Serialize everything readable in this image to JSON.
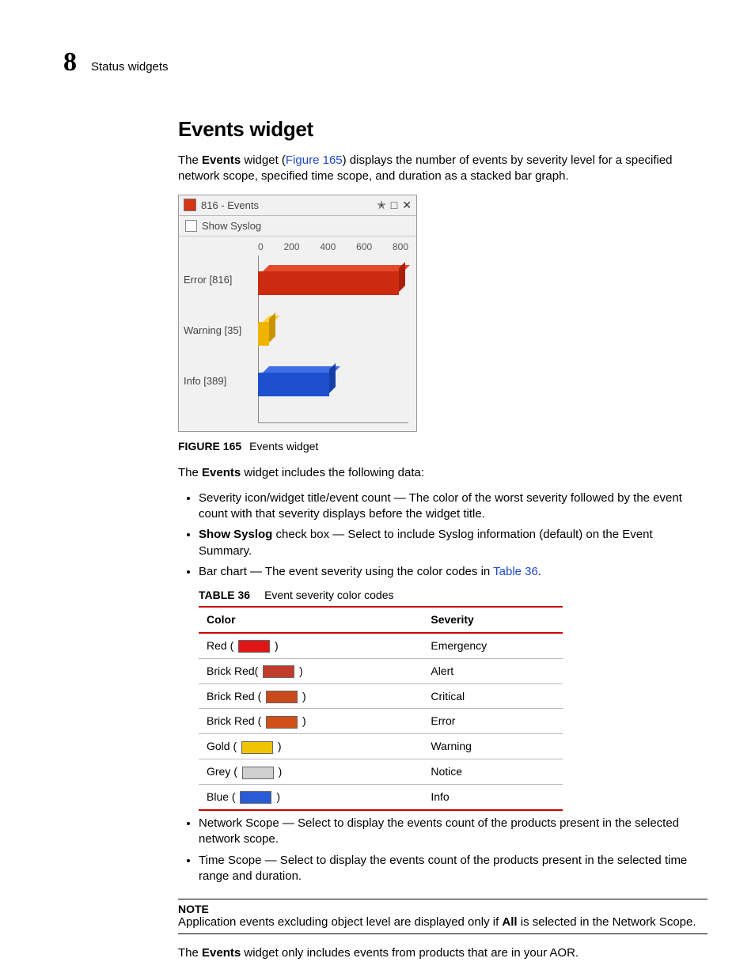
{
  "header": {
    "chapter_number": "8",
    "breadcrumb": "Status widgets"
  },
  "section": {
    "title": "Events widget",
    "intro_pre": "The ",
    "intro_bold": "Events",
    "intro_mid": " widget (",
    "intro_link": "Figure 165",
    "intro_post": ") displays the number of events by severity level for a specified network scope, specified time scope, and duration as a stacked bar graph."
  },
  "widget": {
    "title": "816 - Events",
    "show_syslog_label": "Show Syslog",
    "ticks": [
      "0",
      "200",
      "400",
      "600",
      "800"
    ]
  },
  "chart_data": {
    "type": "bar",
    "orientation": "horizontal",
    "categories": [
      "Error [816]",
      "Warning [35]",
      "Info [389]"
    ],
    "values": [
      816,
      35,
      389
    ],
    "colors": [
      "#cc2b10",
      "#f0b400",
      "#1d4fcf"
    ],
    "xlim": [
      0,
      800
    ],
    "title": "816 - Events",
    "xlabel": "",
    "ylabel": ""
  },
  "figure": {
    "label": "FIGURE 165",
    "caption": "Events widget"
  },
  "includes": {
    "lead_pre": "The ",
    "lead_bold": "Events",
    "lead_post": " widget includes the following data:"
  },
  "bullets1": {
    "b1": "Severity icon/widget title/event count — The color of the worst severity followed by the event count with that severity displays before the widget title.",
    "b2_bold": "Show Syslog",
    "b2_rest": " check box — Select to include Syslog information (default) on the Event Summary.",
    "b3_pre": "Bar chart — The event severity using the color codes in ",
    "b3_link": "Table 36",
    "b3_post": "."
  },
  "table": {
    "label": "TABLE 36",
    "caption": "Event severity color codes",
    "head_color": "Color",
    "head_sev": "Severity",
    "rows": [
      {
        "name": "Red",
        "open": "Red ( ",
        "swatch": "#e01616",
        "close": " )",
        "severity": "Emergency"
      },
      {
        "name": "Brick Red",
        "open": "Brick Red( ",
        "swatch": "#c23a2a",
        "close": " )",
        "severity": "Alert"
      },
      {
        "name": "Brick Red",
        "open": "Brick Red ( ",
        "swatch": "#c84a1c",
        "close": " )",
        "severity": "Critical"
      },
      {
        "name": "Brick Red",
        "open": "Brick Red ( ",
        "swatch": "#d25018",
        "close": " )",
        "severity": "Error"
      },
      {
        "name": "Gold",
        "open": "Gold ( ",
        "swatch": "#f0c400",
        "close": " )",
        "severity": "Warning"
      },
      {
        "name": "Grey",
        "open": "Grey ( ",
        "swatch": "#cfcfcf",
        "close": " )",
        "severity": "Notice"
      },
      {
        "name": "Blue",
        "open": "Blue ( ",
        "swatch": "#2a5bd7",
        "close": " )",
        "severity": "Info"
      }
    ]
  },
  "bullets2": {
    "b1": "Network Scope — Select to display the events count of the products present in the selected network scope.",
    "b2": "Time Scope — Select to display the events count of the products present in the selected time range and duration."
  },
  "note": {
    "label": "NOTE",
    "text_pre": "Application events excluding object level are displayed only if ",
    "text_bold": "All",
    "text_post": " is selected in the Network Scope."
  },
  "closing": {
    "pre": "The ",
    "bold": "Events",
    "post": " widget only includes events from products that are in your AOR."
  }
}
